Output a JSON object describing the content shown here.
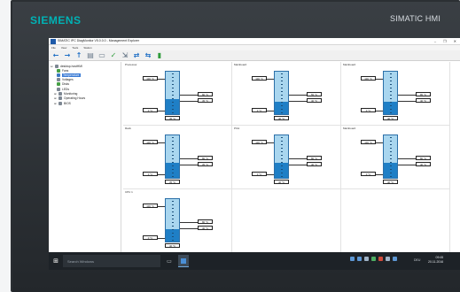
{
  "device": {
    "brand": "SIEMENS",
    "model": "SIMATIC HMI"
  },
  "window": {
    "title": "SIMATIC IPC DiagMonitor V5.0.0.0 - Management Explorer",
    "controls": {
      "minimize": "–",
      "maximize": "❐",
      "close": "✕"
    }
  },
  "menu": {
    "items": [
      "File",
      "View",
      "Tools",
      "Station"
    ]
  },
  "toolbar": {
    "icons": [
      "back-arrow-icon",
      "forward-arrow-icon",
      "up-arrow-icon",
      "folder-icon",
      "monitor-icon",
      "check-icon",
      "export-icon",
      "connect-icon",
      "disconnect-icon",
      "settings-icon"
    ]
  },
  "tree": {
    "root": "desktop-hostHMI",
    "items": [
      {
        "label": "Fans",
        "level": 1
      },
      {
        "label": "Temperature",
        "level": 1,
        "selected": true
      },
      {
        "label": "Voltages",
        "level": 1
      },
      {
        "label": "Disks",
        "level": 1
      },
      {
        "label": "LEDs",
        "level": 1
      },
      {
        "label": "Monitoring",
        "level": 1
      },
      {
        "label": "Operating Hours",
        "level": 1
      },
      {
        "label": "BIOS",
        "level": 1
      }
    ]
  },
  "sensors": [
    {
      "name": "Processor",
      "max": "100 °C",
      "min": "0 °C",
      "upper": "80 °C",
      "current": "45 °C",
      "level": 0.35
    },
    {
      "name": "Mainboard",
      "max": "100 °C",
      "min": "0 °C",
      "upper": "55 °C",
      "current": "40 °C",
      "level": 0.3
    },
    {
      "name": "Mainboard",
      "max": "100 °C",
      "min": "0 °C",
      "upper": "85 °C",
      "current": "40 °C",
      "level": 0.3
    },
    {
      "name": "Rack",
      "max": "100 °C",
      "min": "0 °C",
      "upper": "80 °C",
      "current": "35 °C",
      "level": 0.35
    },
    {
      "name": "PCH",
      "max": "100 °C",
      "min": "0 °C",
      "upper": "80 °C",
      "current": "40 °C",
      "level": 0.35
    },
    {
      "name": "Mainboard",
      "max": "100 °C",
      "min": "0 °C",
      "upper": "80 °C",
      "current": "40 °C",
      "level": 0.35
    },
    {
      "name": "CPU 1",
      "max": "100 °C",
      "min": "0 °C",
      "upper": "80 °C",
      "current": "40 °C",
      "level": 0.3
    }
  ],
  "taskbar": {
    "search_placeholder": "Search Windows",
    "language": "DEU",
    "time": "09:45",
    "date": "20.11.2016"
  },
  "colors": {
    "gauge_fill": "#1f7fc6",
    "gauge_bg": "#a9d6ef",
    "brand": "#00b2b5"
  }
}
